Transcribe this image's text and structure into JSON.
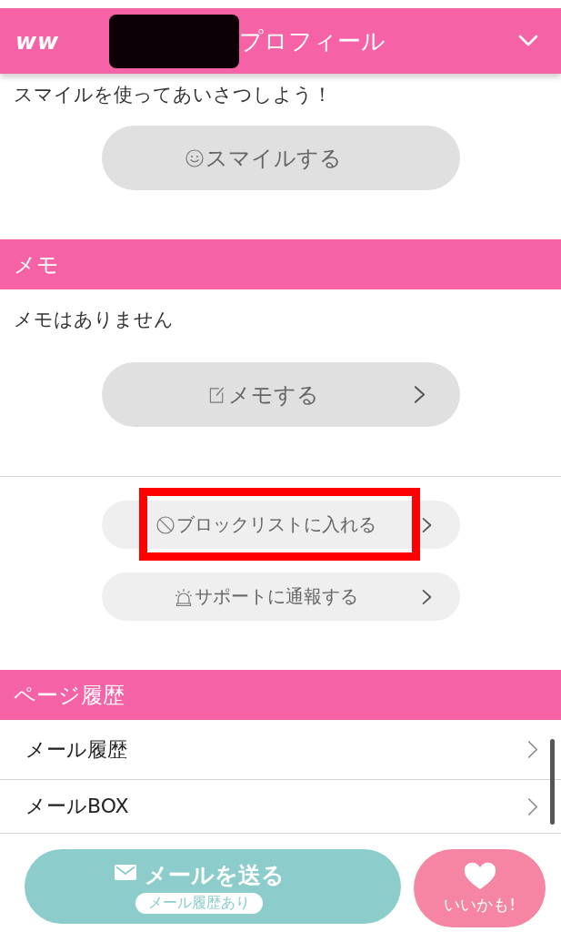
{
  "header": {
    "logo": "ww",
    "title": "プロフィール",
    "name_redacted": true
  },
  "smile_section": {
    "prompt": "スマイルを使ってあいさつしよう！",
    "button_label": "スマイルする"
  },
  "memo_section": {
    "title": "メモ",
    "empty_text": "メモはありません",
    "button_label": "メモする"
  },
  "actions": [
    {
      "kind": "block",
      "label": "ブロックリストに入れる",
      "highlighted": true
    },
    {
      "kind": "report",
      "label": "サポートに通報する",
      "highlighted": false
    }
  ],
  "history_section": {
    "title": "ページ履歴",
    "items": [
      {
        "label": "メール履歴"
      },
      {
        "label": "メールBOX"
      }
    ]
  },
  "bottom_bar": {
    "send_mail": {
      "label": "メールを送る",
      "badge": "メール履歴あり"
    },
    "like": {
      "label": "いいかも!"
    }
  }
}
